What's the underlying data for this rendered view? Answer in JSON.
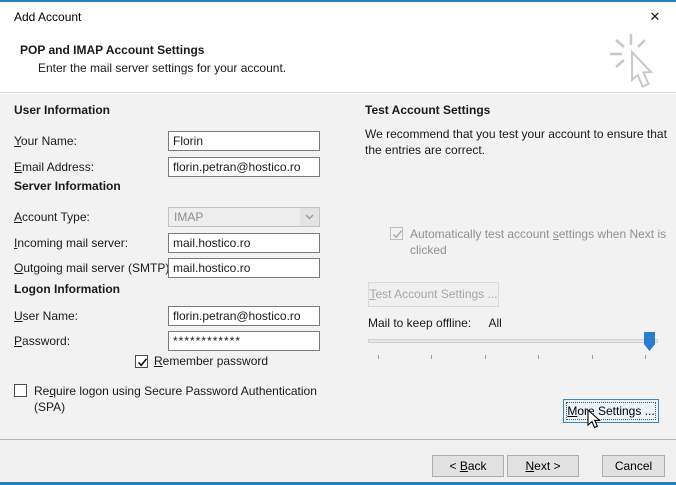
{
  "window": {
    "title": "Add Account",
    "close_icon": "✕"
  },
  "header": {
    "title": "POP and IMAP Account Settings",
    "subtitle": "Enter the mail server settings for your account."
  },
  "colors": {
    "accent_border": "#2b7cb8",
    "slider_thumb": "#2b7cd3",
    "focus_button_border": "#3a87c8",
    "body_background": "#f2f2f2",
    "footer_background": "#f0f0f0"
  },
  "left": {
    "sections": {
      "user_info": "User Information",
      "server_info": "Server Information",
      "logon_info": "Logon Information"
    },
    "fields": {
      "your_name": {
        "pre": "",
        "key": "Y",
        "post": "our Name:",
        "value": "Florin"
      },
      "email": {
        "pre": "",
        "key": "E",
        "post": "mail Address:",
        "value": "florin.petran@hostico.ro"
      },
      "account_type": {
        "pre": "",
        "key": "A",
        "post": "ccount Type:",
        "value": "IMAP",
        "disabled": true
      },
      "incoming": {
        "pre": "",
        "key": "I",
        "post": "ncoming mail server:",
        "value": "mail.hostico.ro"
      },
      "outgoing": {
        "pre": "",
        "key": "O",
        "post": "utgoing mail server (SMTP):",
        "value": "mail.hostico.ro"
      },
      "username": {
        "pre": "",
        "key": "U",
        "post": "ser Name:",
        "value": "florin.petran@hostico.ro"
      },
      "password": {
        "pre": "",
        "key": "P",
        "post": "assword:",
        "value": "************"
      }
    },
    "remember_password": {
      "pre": "",
      "key": "R",
      "post": "emember password",
      "checked": true
    },
    "spa": {
      "pre": "Re",
      "key": "q",
      "post": "uire logon using Secure Password Authentication (SPA)",
      "checked": false
    }
  },
  "right": {
    "title": "Test Account Settings",
    "description": "We recommend that you test your account to ensure that the entries are correct.",
    "test_button": {
      "pre": "",
      "key": "T",
      "post": "est Account Settings ...",
      "disabled": true
    },
    "auto_test": {
      "pre": "Automatically test account ",
      "key": "s",
      "post": "ettings when Next is clicked",
      "checked": true,
      "disabled": true
    },
    "offline_slider": {
      "label": "Mail to keep offline:",
      "value": "All",
      "position": "max"
    },
    "more_settings": {
      "pre": "",
      "key": "M",
      "post": "ore Settings ..."
    }
  },
  "footer": {
    "back": {
      "pre": "< ",
      "key": "B",
      "post": "ack"
    },
    "next": {
      "pre": "",
      "key": "N",
      "post": "ext >"
    },
    "cancel": "Cancel"
  }
}
